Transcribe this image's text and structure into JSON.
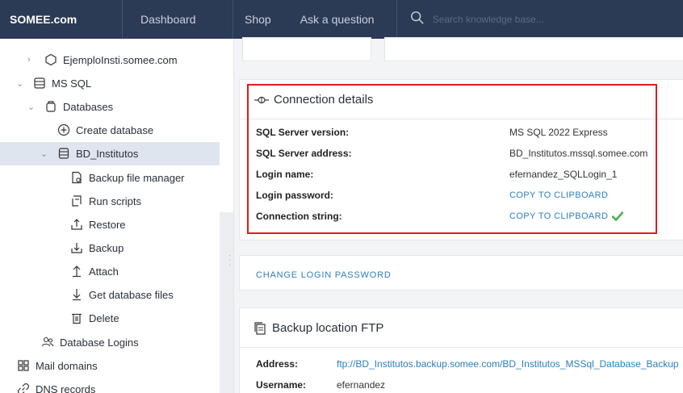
{
  "topbar": {
    "brand": "SOMEE.com",
    "nav": [
      "Dashboard",
      "Shop",
      "Ask a question"
    ],
    "search_placeholder": "Search knowledge base..."
  },
  "sidebar": {
    "items": [
      {
        "label": "EjemploInsti.somee.com",
        "icon": "globe-outline-icon"
      },
      {
        "label": "MS SQL",
        "icon": "database-server-icon"
      },
      {
        "label": "Databases",
        "icon": "databases-icon"
      },
      {
        "label": "Create database",
        "icon": "plus-circle-icon"
      },
      {
        "label": "BD_Institutos",
        "icon": "database-icon"
      },
      {
        "label": "Backup file manager",
        "icon": "file-gear-icon"
      },
      {
        "label": "Run scripts",
        "icon": "script-icon"
      },
      {
        "label": "Restore",
        "icon": "restore-icon"
      },
      {
        "label": "Backup",
        "icon": "backup-icon"
      },
      {
        "label": "Attach",
        "icon": "arrow-up-icon"
      },
      {
        "label": "Get database files",
        "icon": "arrow-down-icon"
      },
      {
        "label": "Delete",
        "icon": "trash-icon"
      },
      {
        "label": "Database Logins",
        "icon": "users-icon"
      },
      {
        "label": "Mail domains",
        "icon": "grid-icon"
      },
      {
        "label": "DNS records",
        "icon": "link-icon"
      }
    ]
  },
  "connection": {
    "title": "Connection details",
    "rows": [
      {
        "label": "SQL Server version:",
        "value": "MS SQL 2022 Express"
      },
      {
        "label": "SQL Server address:",
        "value": "BD_Institutos.mssql.somee.com"
      },
      {
        "label": "Login name:",
        "value": "efernandez_SQLLogin_1"
      },
      {
        "label": "Login password:",
        "value": "COPY TO CLIPBOARD"
      },
      {
        "label": "Connection string:",
        "value": "COPY TO CLIPBOARD"
      }
    ],
    "change_password": "CHANGE LOGIN PASSWORD"
  },
  "backup_ftp": {
    "title": "Backup location FTP",
    "rows": [
      {
        "label": "Address:",
        "value": "ftp://BD_Institutos.backup.somee.com/BD_Institutos_MSSql_Database_Backup"
      },
      {
        "label": "Username:",
        "value": "efernandez"
      }
    ]
  },
  "colors": {
    "topbar": "#2b3a55",
    "link": "#2d7fbf",
    "highlight": "#e01b1b",
    "check": "#4caf50"
  }
}
